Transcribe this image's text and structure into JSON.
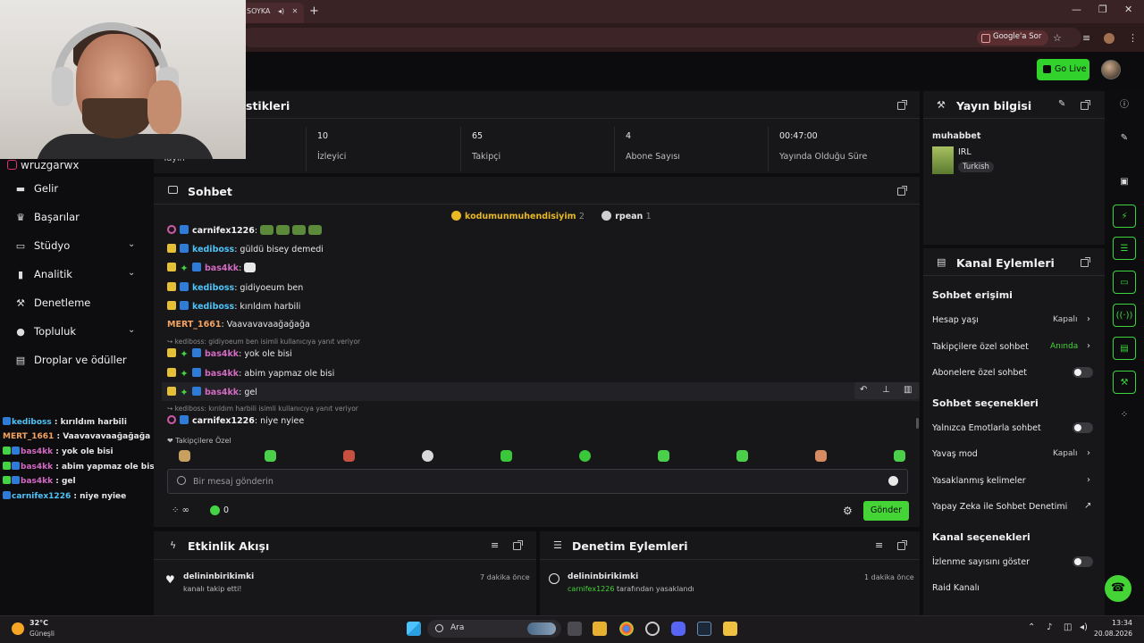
{
  "browser": {
    "tab_title": "SOYKA",
    "google_button": "Google'a Sor"
  },
  "topbar": {
    "go_live": "Go Live"
  },
  "webcam": {
    "handle": "wruzgarwx"
  },
  "sidebar": {
    "items": [
      {
        "label": "Gelir",
        "icon": "money-icon"
      },
      {
        "label": "Başarılar",
        "icon": "trophy-icon"
      },
      {
        "label": "Stüdyo",
        "icon": "studio-icon",
        "expandable": true
      },
      {
        "label": "Analitik",
        "icon": "analytics-icon",
        "expandable": true
      },
      {
        "label": "Denetleme",
        "icon": "hammer-icon"
      },
      {
        "label": "Topluluk",
        "icon": "community-icon",
        "expandable": true
      },
      {
        "label": "Droplar ve ödüller",
        "icon": "drops-icon"
      }
    ]
  },
  "overlay_chat": [
    {
      "user": "kediboss",
      "text": " : kırıldım harbili",
      "color": "#4fc3f7"
    },
    {
      "user": "MERT_1661",
      "text": " : Vaavavavaağağağa",
      "color": "#f4a460"
    },
    {
      "user": "bas4kk",
      "text": " : yok ole bisi",
      "color": "#d36ac2"
    },
    {
      "user": "bas4kk",
      "text": " : abim yapmaz ole bisi",
      "color": "#d36ac2"
    },
    {
      "user": "bas4kk",
      "text": " : gel",
      "color": "#d36ac2"
    },
    {
      "user": "carnifex1226",
      "text": " : niye nyiee",
      "color": "#4fc3f7"
    }
  ],
  "stats": {
    "title_fragment": "stikleri",
    "first_label": "Yayın",
    "cells": [
      {
        "value": "10",
        "label": "İzleyici"
      },
      {
        "value": "65",
        "label": "Takipçi"
      },
      {
        "value": "4",
        "label": "Abone Sayısı"
      },
      {
        "value": "00:47:00",
        "label": "Yayında Olduğu Süre"
      }
    ]
  },
  "chat": {
    "title": "Sohbet",
    "pinned": [
      {
        "user": "kodumunmuhendisiyim",
        "count": "2",
        "color": "#e8b923"
      },
      {
        "user": "rpean",
        "count": "1",
        "color": "#e6e6e6"
      }
    ],
    "messages": [
      {
        "user": "carnifex1226",
        "color": "#f2f2f2",
        "badges": [
          "pink",
          "kick"
        ],
        "text": ":",
        "emotes": 4
      },
      {
        "user": "kediboss",
        "color": "#4fc3f7",
        "badges": [
          "sub",
          "kick"
        ],
        "text": ": güldü bisey demedi"
      },
      {
        "user": "bas4kk",
        "color": "#d36ac2",
        "badges": [
          "sub",
          "green",
          "kick"
        ],
        "text": ":",
        "emotes": 1
      },
      {
        "user": "kediboss",
        "color": "#4fc3f7",
        "badges": [
          "sub",
          "kick"
        ],
        "text": ": gidiyoeum ben"
      },
      {
        "user": "kediboss",
        "color": "#4fc3f7",
        "badges": [
          "sub",
          "kick"
        ],
        "text": ": kırıldım harbili"
      },
      {
        "user": "MERT_1661",
        "color": "#f4a460",
        "badges": [],
        "text": ": Vaavavavaağağağa"
      },
      {
        "reply": "kediboss: gidiyoeum ben isimli kullanıcıya yanıt veriyor"
      },
      {
        "user": "bas4kk",
        "color": "#d36ac2",
        "badges": [
          "sub",
          "green",
          "kick"
        ],
        "text": ": yok ole bisi"
      },
      {
        "user": "bas4kk",
        "color": "#d36ac2",
        "badges": [
          "sub",
          "green",
          "kick"
        ],
        "text": ": abim yapmaz ole bisi"
      },
      {
        "user": "bas4kk",
        "color": "#d36ac2",
        "badges": [
          "sub",
          "green",
          "kick"
        ],
        "text": ": gel"
      },
      {
        "reply": "kediboss: kırıldım harbili isimli kullanıcıya yanıt veriyor"
      },
      {
        "user": "carnifex1226",
        "color": "#f2f2f2",
        "badges": [
          "pink",
          "kick"
        ],
        "text": ": niye nyiee"
      }
    ],
    "followers_only": "Takipçilere Özel",
    "input_placeholder": "Bir mesaj gönderin",
    "points_value": "0",
    "send_label": "Gönder"
  },
  "stream_info": {
    "title": "Yayın bilgisi",
    "stream_title": "muhabbet",
    "category": "IRL",
    "language": "Turkish"
  },
  "channel_actions": {
    "title": "Kanal Eylemleri",
    "chat_access_heading": "Sohbet erişimi",
    "account_age_label": "Hesap yaşı",
    "account_age_value": "Kapalı",
    "followers_chat_label": "Takipçilere özel sohbet",
    "followers_chat_value": "Anında",
    "subs_chat_label": "Abonelere özel sohbet",
    "chat_options_heading": "Sohbet seçenekleri",
    "emote_only_label": "Yalnızca Emotlarla sohbet",
    "slow_mode_label": "Yavaş mod",
    "slow_mode_value": "Kapalı",
    "banned_words_label": "Yasaklanmış kelimeler",
    "ai_moderation_label": "Yapay Zeka ile Sohbet Denetimi",
    "channel_options_heading": "Kanal seçenekleri",
    "show_viewers_label": "İzlenme sayısını göster",
    "raid_label": "Raid Kanalı"
  },
  "activity_feed": {
    "title": "Etkinlik Akışı",
    "item_user": "delininbirikimki",
    "item_text": "kanalı takip etti!",
    "item_time": "7 dakika önce"
  },
  "mod_actions": {
    "title": "Denetim Eylemleri",
    "item_user": "delininbirikimki",
    "item_actor": "carnifex1226",
    "item_text": " tarafından yasaklandı",
    "item_time": "1 dakika önce"
  },
  "taskbar": {
    "temp": "32°C",
    "weather": "Güneşli",
    "search": "Ara",
    "time": "13:34",
    "date": "20.08.2026"
  },
  "colors": {
    "accent": "#44d436",
    "panel": "#17171a",
    "background": "#0d0d0f"
  }
}
